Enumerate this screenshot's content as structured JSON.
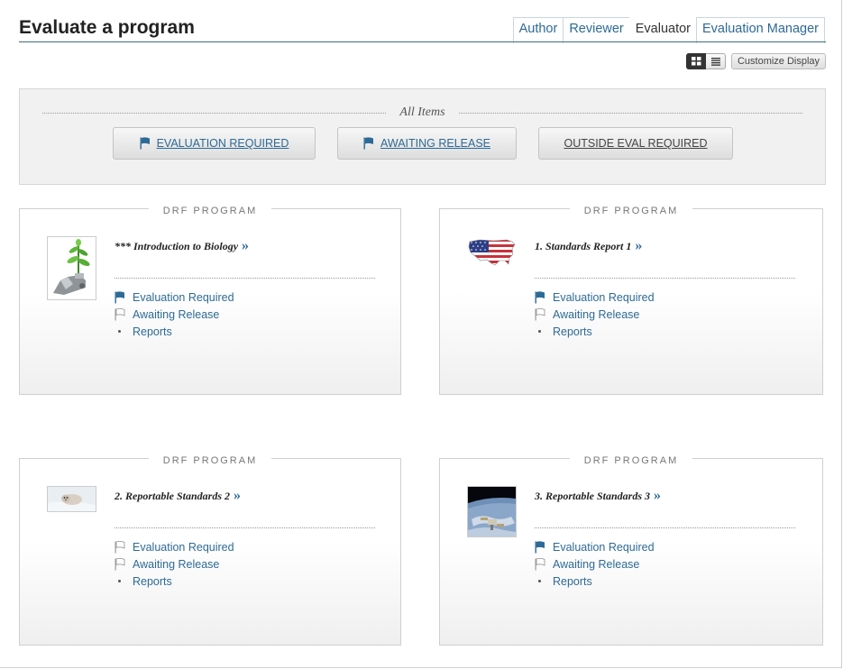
{
  "header": {
    "title": "Evaluate a program"
  },
  "tabs": [
    {
      "label": "Author",
      "active": false
    },
    {
      "label": "Reviewer",
      "active": false
    },
    {
      "label": "Evaluator",
      "active": true
    },
    {
      "label": "Evaluation Manager",
      "active": false
    }
  ],
  "view": {
    "mode": "grid",
    "customize_label": "Customize Display"
  },
  "filters": {
    "heading": "All Items",
    "buttons": [
      {
        "label": "EVALUATION REQUIRED",
        "icon": "blue-flag-icon"
      },
      {
        "label": "AWAITING RELEASE",
        "icon": "blue-flag-icon"
      },
      {
        "label": "OUTSIDE EVAL REQUIRED",
        "icon": ""
      }
    ]
  },
  "cards": [
    {
      "type_label": "DRF PROGRAM",
      "title": "*** Introduction to Biology",
      "raquo": "»",
      "thumbnail": "robot-hand-plant",
      "links": [
        {
          "label": "Evaluation Required",
          "icon": "blue-flag-icon"
        },
        {
          "label": "Awaiting Release",
          "icon": "white-flag-icon"
        },
        {
          "label": "Reports",
          "icon": "bullet"
        }
      ]
    },
    {
      "type_label": "DRF PROGRAM",
      "title": "1. Standards Report 1",
      "raquo": "»",
      "thumbnail": "us-flag-map",
      "links": [
        {
          "label": "Evaluation Required",
          "icon": "blue-flag-icon"
        },
        {
          "label": "Awaiting Release",
          "icon": "white-flag-icon"
        },
        {
          "label": "Reports",
          "icon": "bullet"
        }
      ]
    },
    {
      "type_label": "DRF PROGRAM",
      "title": "2. Reportable Standards 2",
      "raquo": "»",
      "thumbnail": "seal-pup",
      "links": [
        {
          "label": "Evaluation Required",
          "icon": "white-flag-icon"
        },
        {
          "label": "Awaiting Release",
          "icon": "white-flag-icon"
        },
        {
          "label": "Reports",
          "icon": "bullet"
        }
      ]
    },
    {
      "type_label": "DRF PROGRAM",
      "title": "3. Reportable Standards 3",
      "raquo": "»",
      "thumbnail": "space-station-earth",
      "links": [
        {
          "label": "Evaluation Required",
          "icon": "blue-flag-icon"
        },
        {
          "label": "Awaiting Release",
          "icon": "white-flag-icon"
        },
        {
          "label": "Reports",
          "icon": "bullet"
        }
      ]
    }
  ],
  "colors": {
    "link": "#2d6a96",
    "flag": "#2d6a96",
    "rule": "#3b6e85"
  }
}
